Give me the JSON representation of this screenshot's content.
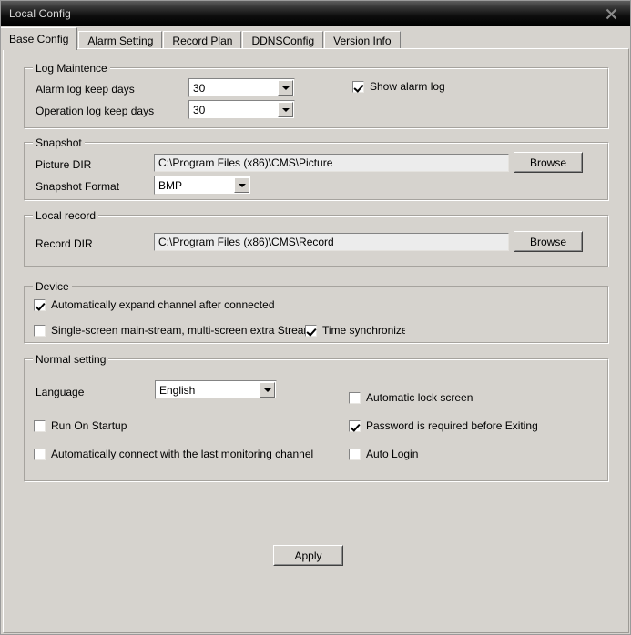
{
  "window": {
    "title": "Local Config",
    "close_icon": "close-icon",
    "background_color": "#d6d3ce",
    "titlebar_color": "#000000"
  },
  "tabs": [
    {
      "label": "Base Config",
      "active": true
    },
    {
      "label": "Alarm Setting",
      "active": false
    },
    {
      "label": "Record Plan",
      "active": false
    },
    {
      "label": "DDNSConfig",
      "active": false
    },
    {
      "label": "Version Info",
      "active": false
    }
  ],
  "log_maintence": {
    "title": "Log Maintence",
    "alarm_log_label": "Alarm log keep days",
    "alarm_log_value": "30",
    "operation_log_label": "Operation log keep days",
    "operation_log_value": "30",
    "show_alarm_log_label": "Show alarm log",
    "show_alarm_log_checked": true
  },
  "snapshot": {
    "title": "Snapshot",
    "picture_dir_label": "Picture DIR",
    "picture_dir_value": "C:\\Program Files (x86)\\CMS\\Picture",
    "browse_label": "Browse",
    "format_label": "Snapshot Format",
    "format_value": "BMP"
  },
  "local_record": {
    "title": "Local record",
    "record_dir_label": "Record DIR",
    "record_dir_value": "C:\\Program Files (x86)\\CMS\\Record",
    "browse_label": "Browse"
  },
  "device": {
    "title": "Device",
    "auto_expand_label": "Automatically expand channel after connected",
    "auto_expand_checked": true,
    "single_screen_label": "Single-screen main-stream, multi-screen extra Stream",
    "single_screen_checked": false,
    "time_sync_label": "Time synchronize",
    "time_sync_checked": true
  },
  "normal_setting": {
    "title": "Normal setting",
    "language_label": "Language",
    "language_value": "English",
    "run_on_startup_label": "Run On Startup",
    "run_on_startup_checked": false,
    "auto_connect_label": "Automatically connect with the last monitoring channel",
    "auto_connect_checked": false,
    "auto_lock_label": "Automatic lock screen",
    "auto_lock_checked": false,
    "password_exit_label": "Password is required before Exiting",
    "password_exit_checked": true,
    "auto_login_label": "Auto Login",
    "auto_login_checked": false
  },
  "footer": {
    "apply_label": "Apply"
  }
}
